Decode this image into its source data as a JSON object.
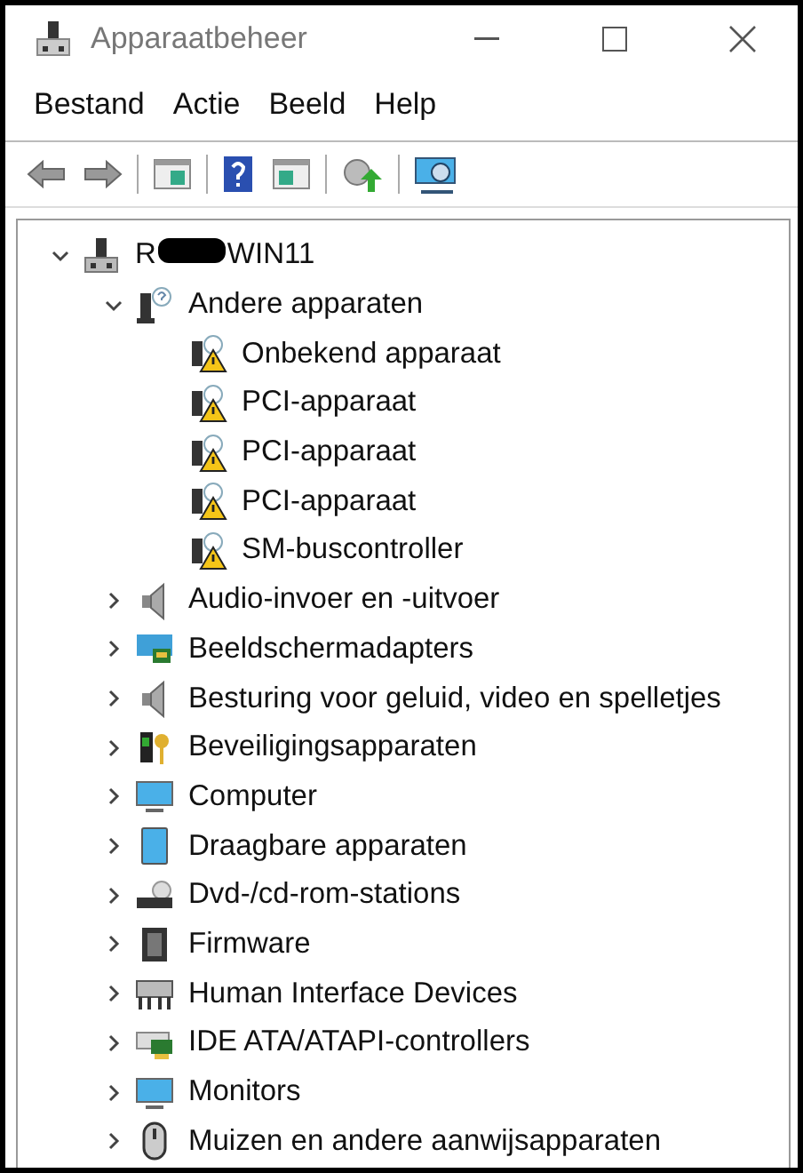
{
  "window": {
    "title": "Apparaatbeheer"
  },
  "menu": [
    "Bestand",
    "Actie",
    "Beeld",
    "Help"
  ],
  "tree": {
    "label_start": "R",
    "label_end": "WIN11",
    "redacted": true,
    "expanded": true,
    "children": [
      {
        "label": "Andere apparaten",
        "expanded": true,
        "children": [
          {
            "label": "Onbekend apparaat"
          },
          {
            "label": "PCI-apparaat"
          },
          {
            "label": "PCI-apparaat"
          },
          {
            "label": "PCI-apparaat"
          },
          {
            "label": "SM-buscontroller"
          }
        ]
      },
      {
        "label": "Audio-invoer en -uitvoer",
        "expanded": false
      },
      {
        "label": "Beeldschermadapters",
        "expanded": false
      },
      {
        "label": "Besturing voor geluid, video en spelletjes",
        "expanded": false
      },
      {
        "label": "Beveiligingsapparaten",
        "expanded": false
      },
      {
        "label": "Computer",
        "expanded": false
      },
      {
        "label": "Draagbare apparaten",
        "expanded": false
      },
      {
        "label": "Dvd-/cd-rom-stations",
        "expanded": false
      },
      {
        "label": "Firmware",
        "expanded": false
      },
      {
        "label": "Human Interface Devices",
        "expanded": false
      },
      {
        "label": "IDE ATA/ATAPI-controllers",
        "expanded": false
      },
      {
        "label": "Monitors",
        "expanded": false
      },
      {
        "label": "Muizen en andere aanwijsapparaten",
        "expanded": false
      }
    ]
  }
}
